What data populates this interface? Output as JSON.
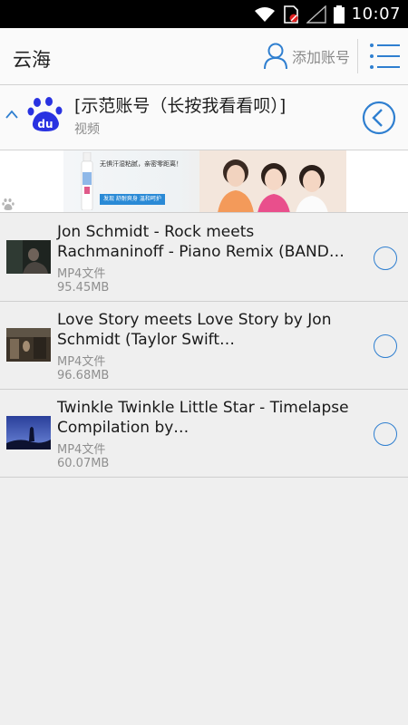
{
  "status_bar": {
    "time": "10:07",
    "icons": [
      "wifi-icon",
      "sim-blocked-icon",
      "signal-icon",
      "battery-icon"
    ]
  },
  "header": {
    "title": "云海",
    "add_account_label": "添加账号",
    "icons": [
      "user-add-icon",
      "menu-list-icon"
    ]
  },
  "account": {
    "name": "[示范账号（长按我看看呗）]",
    "category": "视频",
    "logo_text": "du",
    "icons": [
      "collapse-icon",
      "baidu-paw-logo",
      "back-circle-icon"
    ]
  },
  "ad": {
    "line1": "无惧汗湿粘腻，亲密零距离！",
    "cta": "发现 舒耐爽身 温和呵护"
  },
  "files": [
    {
      "title": "Jon Schmidt - Rock meets Rachmaninoff - Piano Remix (BAND…",
      "type": "MP4文件",
      "size": "95.45MB"
    },
    {
      "title": "Love Story meets Love Story by Jon Schmidt (Taylor Swift…",
      "type": "MP4文件",
      "size": "96.68MB"
    },
    {
      "title": "Twinkle Twinkle Little Star - Timelapse Compilation by…",
      "type": "MP4文件",
      "size": "60.07MB"
    }
  ],
  "colors": {
    "accent": "#2f7fd0",
    "baidu_blue": "#2932e1",
    "header_bg": "#fafafa",
    "list_bg": "#efefef"
  }
}
